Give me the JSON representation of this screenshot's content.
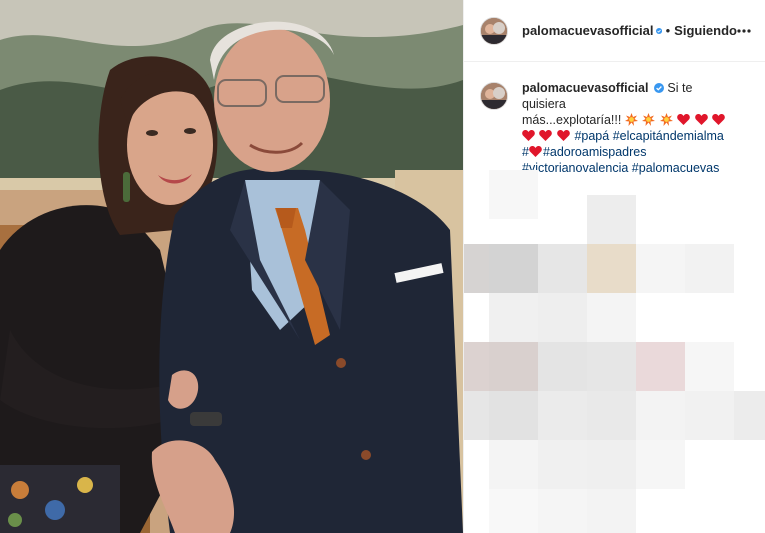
{
  "post": {
    "username": "palomacuevasofficial",
    "separator": "•",
    "follow_status": "Siguiendo",
    "caption": {
      "username": "palomacuevasofficial",
      "line1_text": "Si te quisiera",
      "line2_text": "más...explotaría!!!",
      "hashtags": [
        "#papá",
        "#elcapitándemialma",
        "#",
        "#adoroamispadres",
        "#victorianovalencia",
        "#palomacuevas"
      ]
    }
  },
  "icons": {
    "verified": "verified-badge-icon",
    "more": "more-options-icon",
    "explosion": "collision-emoji-icon",
    "heart": "red-heart-emoji-icon"
  },
  "colors": {
    "link": "#00376b",
    "text": "#262626",
    "verified": "#3897f0",
    "heart": "#e0162b",
    "border": "#efefef"
  }
}
